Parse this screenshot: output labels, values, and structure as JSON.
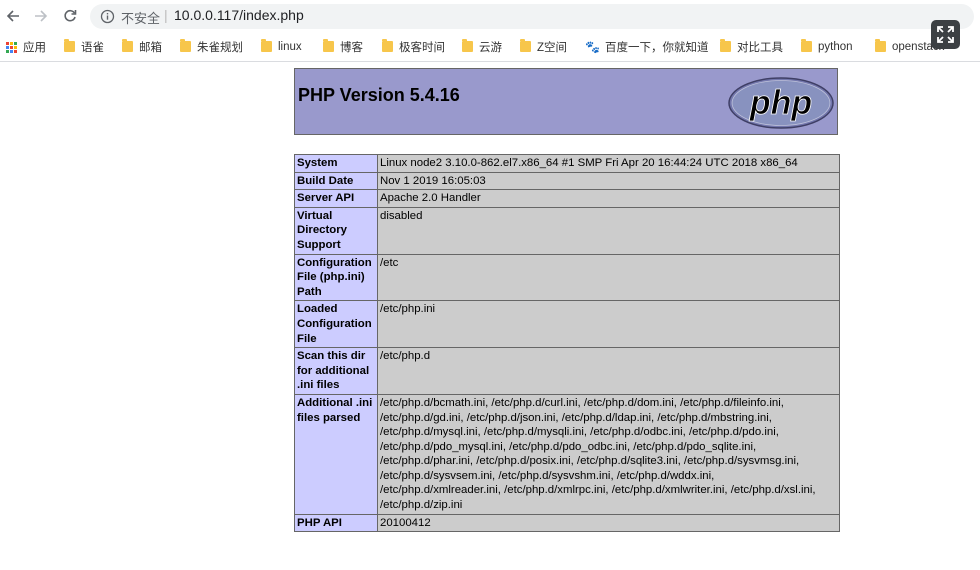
{
  "browser": {
    "back_icon": "arrow-left-icon",
    "forward_icon": "arrow-right-icon",
    "reload_icon": "reload-icon",
    "security_label": "不安全",
    "separator": "|",
    "url": "10.0.0.117/index.php"
  },
  "bookmarks": {
    "apps_label": "应用",
    "items": [
      {
        "label": "语雀",
        "icon": "folder-icon"
      },
      {
        "label": "邮箱",
        "icon": "folder-icon"
      },
      {
        "label": "朱雀规划",
        "icon": "folder-icon"
      },
      {
        "label": "linux",
        "icon": "folder-icon"
      },
      {
        "label": "博客",
        "icon": "folder-icon"
      },
      {
        "label": "极客时间",
        "icon": "folder-icon"
      },
      {
        "label": "云游",
        "icon": "folder-icon"
      },
      {
        "label": "Z空间",
        "icon": "folder-icon"
      },
      {
        "label": "百度一下，你就知道",
        "icon": "baidu-paw-icon"
      },
      {
        "label": "对比工具",
        "icon": "folder-icon"
      },
      {
        "label": "python",
        "icon": "folder-icon"
      },
      {
        "label": "openstack",
        "icon": "folder-icon"
      }
    ]
  },
  "phpinfo": {
    "title": "PHP Version 5.4.16",
    "logo_text": "php",
    "rows": [
      {
        "key": "System",
        "value": "Linux node2 3.10.0-862.el7.x86_64 #1 SMP Fri Apr 20 16:44:24 UTC 2018 x86_64"
      },
      {
        "key": "Build Date",
        "value": "Nov 1 2019 16:05:03"
      },
      {
        "key": "Server API",
        "value": "Apache 2.0 Handler"
      },
      {
        "key": "Virtual Directory Support",
        "value": "disabled"
      },
      {
        "key": "Configuration File (php.ini) Path",
        "value": "/etc"
      },
      {
        "key": "Loaded Configuration File",
        "value": "/etc/php.ini"
      },
      {
        "key": "Scan this dir for additional .ini files",
        "value": "/etc/php.d"
      },
      {
        "key": "Additional .ini files parsed",
        "value": "/etc/php.d/bcmath.ini, /etc/php.d/curl.ini, /etc/php.d/dom.ini, /etc/php.d/fileinfo.ini, /etc/php.d/gd.ini, /etc/php.d/json.ini, /etc/php.d/ldap.ini, /etc/php.d/mbstring.ini, /etc/php.d/mysql.ini, /etc/php.d/mysqli.ini, /etc/php.d/odbc.ini, /etc/php.d/pdo.ini, /etc/php.d/pdo_mysql.ini, /etc/php.d/pdo_odbc.ini, /etc/php.d/pdo_sqlite.ini, /etc/php.d/phar.ini, /etc/php.d/posix.ini, /etc/php.d/sqlite3.ini, /etc/php.d/sysvmsg.ini, /etc/php.d/sysvsem.ini, /etc/php.d/sysvshm.ini, /etc/php.d/wddx.ini, /etc/php.d/xmlreader.ini, /etc/php.d/xmlrpc.ini, /etc/php.d/xmlwriter.ini, /etc/php.d/xsl.ini, /etc/php.d/zip.ini"
      },
      {
        "key": "PHP API",
        "value": "20100412"
      }
    ]
  },
  "colors": {
    "header_bg": "#9999cc",
    "key_cell_bg": "#ccccff",
    "value_cell_bg": "#cccccc",
    "folder_icon": "#f7c64b"
  }
}
